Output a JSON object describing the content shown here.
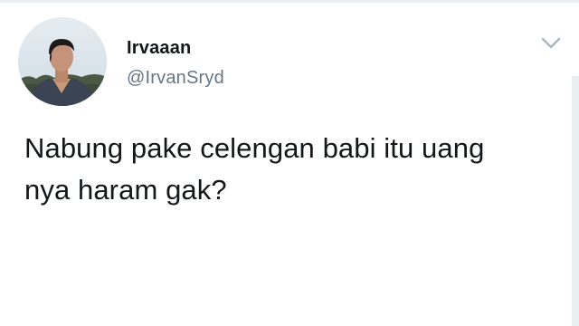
{
  "tweet": {
    "display_name": "Irvaaan",
    "handle": "@IrvanSryd",
    "text_line1": "Nabung pake celengan babi itu uang",
    "text_line2": "nya haram gak?",
    "menu_icon": "chevron-down-icon",
    "avatar_icon": "profile-photo"
  },
  "colors": {
    "name": "#14171a",
    "handle": "#657786",
    "chevron": "#aab8c2",
    "background": "#ffffff"
  }
}
